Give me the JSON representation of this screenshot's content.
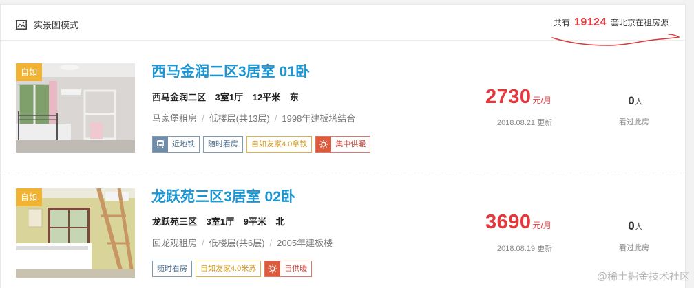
{
  "header": {
    "mode_label": "实景图模式",
    "total_prefix": "共有",
    "total_count": "19124",
    "total_suffix": "套北京在租房源"
  },
  "listings": [
    {
      "badge": "自如",
      "title": "西马金润二区3居室 01卧",
      "specs": {
        "community": "西马金润二区",
        "layout": "3室1厅",
        "area": "12平米",
        "orientation": "东"
      },
      "info": {
        "district": "马家堡租房",
        "floor": "低楼层(共13层)",
        "building": "1998年建板塔结合"
      },
      "tags": [
        "近地铁",
        "随时看房",
        "自如友家4.0拿铁",
        "集中供暖"
      ],
      "price": "2730",
      "price_unit": "元/月",
      "updated": "2018.08.21 更新",
      "viewer_count": "0",
      "viewer_unit": "人",
      "viewer_label": "看过此房"
    },
    {
      "badge": "自如",
      "title": "龙跃苑三区3居室 02卧",
      "specs": {
        "community": "龙跃苑三区",
        "layout": "3室1厅",
        "area": "9平米",
        "orientation": "北"
      },
      "info": {
        "district": "回龙观租房",
        "floor": "低楼层(共6层)",
        "building": "2005年建板楼"
      },
      "tags": [
        "随时看房",
        "自如友家4.0米苏",
        "自供暖"
      ],
      "price": "3690",
      "price_unit": "元/月",
      "updated": "2018.08.19 更新",
      "viewer_count": "0",
      "viewer_unit": "人",
      "viewer_label": "看过此房"
    }
  ],
  "watermark": "@稀土掘金技术社区",
  "colors": {
    "accent_blue": "#1a96d4",
    "price_red": "#e4393c",
    "badge_gold": "#f1b334"
  }
}
